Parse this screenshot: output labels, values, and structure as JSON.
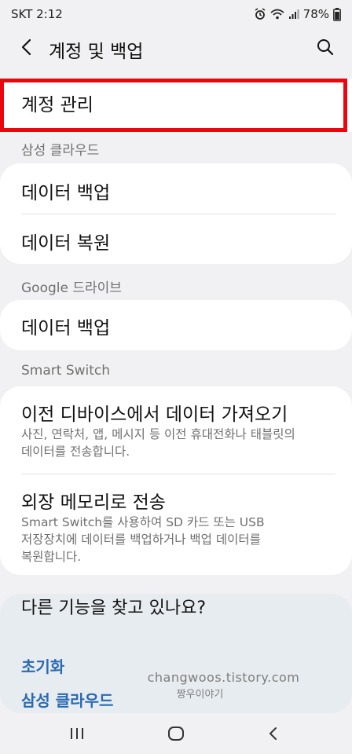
{
  "status_bar": {
    "carrier_time": "SKT 2:12",
    "battery": "78%",
    "icons": [
      "alarm-icon",
      "wifi-icon",
      "signal-icon",
      "battery-icon"
    ]
  },
  "header": {
    "title": "계정 및 백업",
    "back_icon": "chevron-left-icon",
    "search_icon": "search-icon"
  },
  "account_manage": {
    "label": "계정 관리",
    "highlight_color": "#e8070e"
  },
  "samsung_cloud": {
    "header": "삼성 클라우드",
    "items": [
      {
        "title": "데이터 백업"
      },
      {
        "title": "데이터 복원"
      }
    ]
  },
  "google_drive": {
    "header": "Google 드라이브",
    "items": [
      {
        "title": "데이터 백업"
      }
    ]
  },
  "smart_switch": {
    "header": "Smart Switch",
    "items": [
      {
        "title": "이전 디바이스에서 데이터 가져오기",
        "sub_lines": [
          "사진, 연락처, 앱, 메시지 등 이전 휴대전화나 태블릿의",
          "데이터를 전송합니다."
        ]
      },
      {
        "title": "외장 메모리로 전송",
        "sub_lines": [
          "Smart Switch를 사용하여 SD 카드 또는 USB",
          "저장장치에 데이터를 백업하거나 백업 데이터를",
          "복원합니다."
        ]
      }
    ]
  },
  "suggestions": {
    "title": "다른 기능을 찾고 있나요?",
    "links": [
      "초기화",
      "삼성 클라우드"
    ],
    "link_color": "#2a6ab3"
  },
  "watermark": {
    "line1": "changwoos.tistory.com",
    "line2": "짱우이야기"
  },
  "nav_bar": {
    "icons": [
      "recent-apps-icon",
      "home-icon",
      "back-icon"
    ]
  }
}
